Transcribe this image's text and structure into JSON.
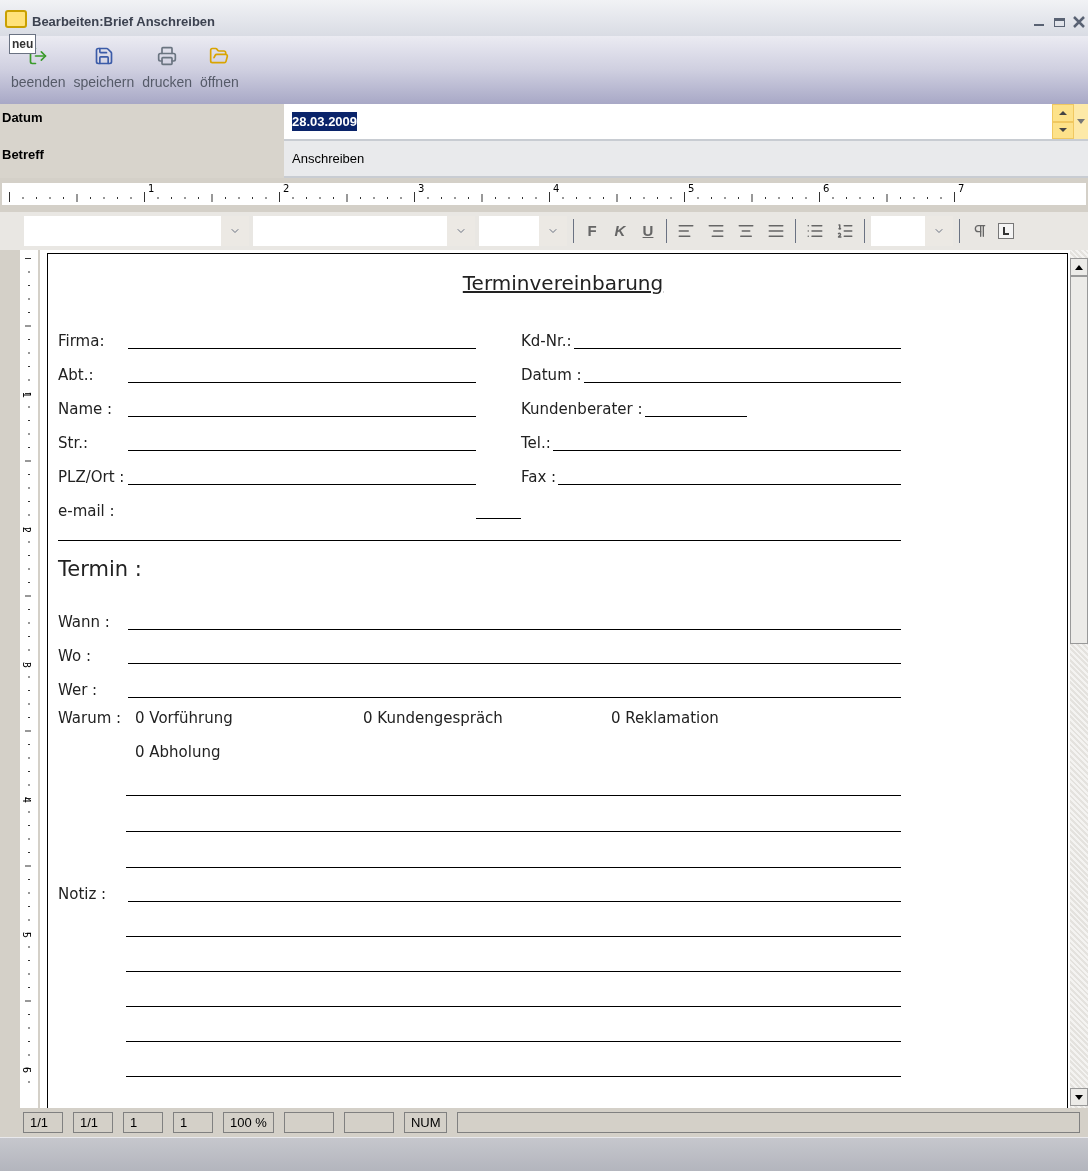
{
  "window": {
    "title": "Bearbeiten:Brief Anschreiben",
    "tooltip": "neu"
  },
  "toolbar": [
    {
      "kind": "exit",
      "label": "beenden"
    },
    {
      "kind": "save",
      "label": "speichern"
    },
    {
      "kind": "print",
      "label": "drucken"
    },
    {
      "kind": "open",
      "label": "öffnen"
    }
  ],
  "fields": [
    {
      "kind": "date",
      "label": "Datum",
      "value": "28.03.2009",
      "selected": true
    },
    {
      "kind": "text",
      "label": "Betreff",
      "value": "Anschreiben",
      "selected": false
    }
  ],
  "ruler": [
    "1",
    "2",
    "3",
    "4",
    "5",
    "6",
    "7"
  ],
  "format_toolbar": {
    "style_buttons": [
      "F",
      "K",
      "U"
    ]
  },
  "vertical_ruler": [
    "1",
    "2",
    "3",
    "4",
    "5",
    "6"
  ],
  "document": {
    "title": "Terminvereinbarung",
    "contact_rows": [
      {
        "kind": "standard",
        "left": "Firma:",
        "right": "Kd-Nr.:"
      },
      {
        "kind": "standard",
        "left": "Abt.:",
        "right": "Datum :"
      },
      {
        "kind": "short",
        "left": "Name :",
        "right": "Kundenberater :"
      },
      {
        "kind": "standard",
        "left": "Str.:",
        "right": "Tel.:"
      },
      {
        "kind": "standard",
        "left": "PLZ/Ort :",
        "right": "Fax :"
      },
      {
        "kind": "single",
        "left": "e-mail :"
      }
    ],
    "heading": "Termin :",
    "termin_rows": [
      "Wann :",
      "Wo :",
      "Wer :"
    ],
    "warum_label": "Warum :",
    "reasons": [
      "0 Vorführung",
      "0 Kundengespräch",
      "0 Reklamation",
      "0 Abholung"
    ],
    "notiz_label": "Notiz :"
  },
  "status_bar": [
    {
      "kind": "text",
      "text": "1/1"
    },
    {
      "kind": "text",
      "text": "1/1"
    },
    {
      "kind": "text",
      "text": "1"
    },
    {
      "kind": "text",
      "text": "1"
    },
    {
      "kind": "text",
      "text": "100 %"
    },
    {
      "kind": "blank"
    },
    {
      "kind": "blank"
    },
    {
      "kind": "text",
      "text": "NUM"
    },
    {
      "kind": "fill"
    }
  ]
}
